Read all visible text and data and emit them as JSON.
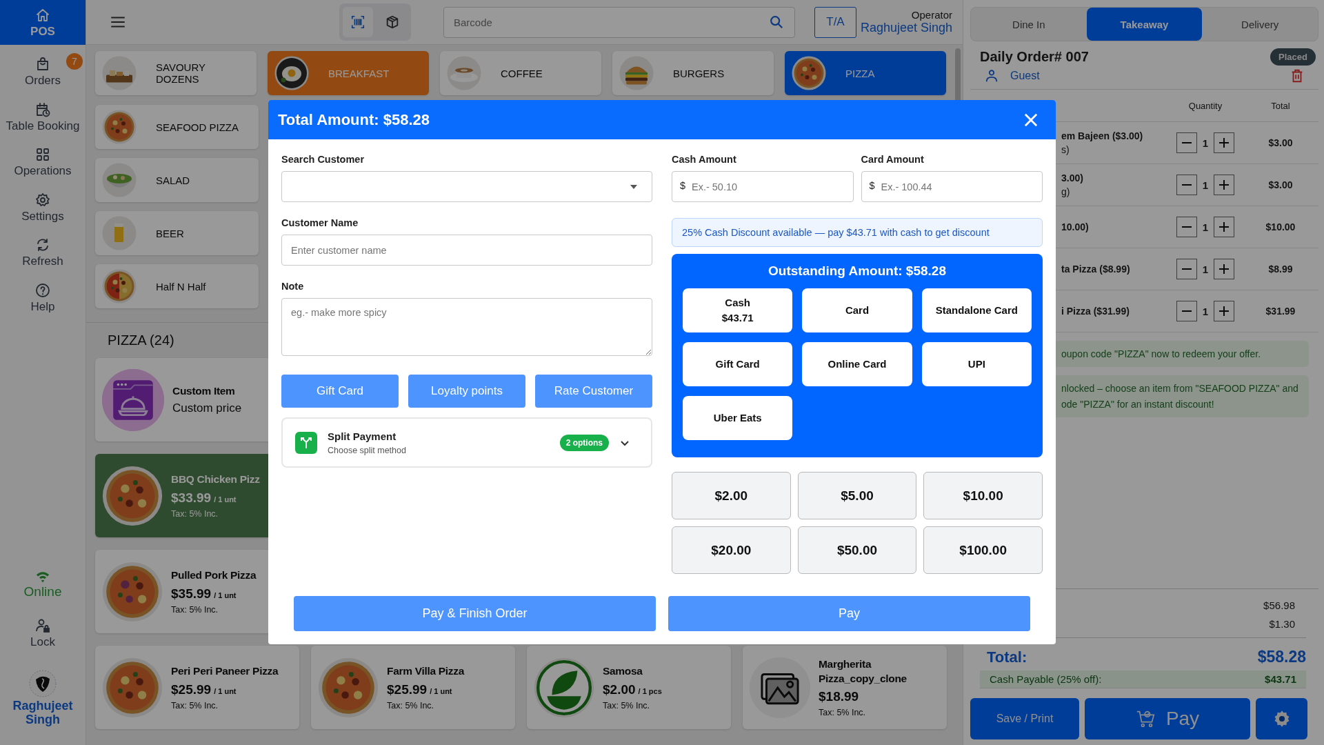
{
  "sidebar": {
    "items": [
      {
        "label": "POS",
        "selected": true
      },
      {
        "label": "Orders",
        "selected": false,
        "badge": "7"
      },
      {
        "label": "Table Booking",
        "selected": false
      },
      {
        "label": "Operations",
        "selected": false
      },
      {
        "label": "Settings",
        "selected": false
      },
      {
        "label": "Refresh",
        "selected": false
      },
      {
        "label": "Help",
        "selected": false
      }
    ],
    "status": {
      "label": "Online",
      "online": true
    },
    "lock": "Lock",
    "user": "Raghujeet Singh"
  },
  "toolbar": {
    "modes": [
      {
        "selected": true
      },
      {
        "selected": false
      }
    ],
    "search": {
      "placeholder": "Barcode"
    },
    "order_type": "T/A",
    "operator": {
      "label": "Operator",
      "name": "Raghujeet Singh"
    }
  },
  "categories": [
    {
      "label": "SAVOURY DOZENS",
      "selected": false
    },
    {
      "label": "BREAKFAST",
      "selected": false,
      "highlighted": true
    },
    {
      "label": "COFFEE",
      "selected": false
    },
    {
      "label": "BURGERS",
      "selected": false
    },
    {
      "label": "PIZZA",
      "selected": true
    },
    {
      "label": "SEAFOOD PIZZA",
      "selected": false
    },
    {
      "label": "SALAD",
      "selected": false
    },
    {
      "label": "BEER",
      "selected": false
    },
    {
      "label": "Half N Half",
      "selected": false
    }
  ],
  "section_title": "PIZZA (24)",
  "products": [
    {
      "kind": "custom",
      "name": "Custom Item",
      "subtitle": "Custom price",
      "selected": false
    },
    {
      "kind": "food",
      "name": "BBQ Chicken Pizz",
      "price": "$33.99",
      "unit": "/ 1 unt",
      "tax": "Tax: 5% Inc.",
      "selected": true
    },
    {
      "kind": "food",
      "name": "Pulled Pork Pizza",
      "price": "$35.99",
      "unit": "/ 1 unt",
      "tax": "Tax: 5% Inc.",
      "selected": false
    },
    {
      "kind": "food",
      "name": "Peri Peri Paneer Pizza",
      "price": "$25.99",
      "unit": "/ 1 unt",
      "tax": "Tax: 5% Inc.",
      "selected": false
    },
    {
      "kind": "food",
      "name": "Farm Villa Pizza",
      "price": "$25.99",
      "unit": "/ 1 unt",
      "tax": "Tax: 5% Inc.",
      "selected": false
    },
    {
      "kind": "food",
      "name": "Samosa",
      "price": "$2.00",
      "unit": "/ 1 pcs",
      "tax": "Tax: 5% Inc.",
      "selected": false
    },
    {
      "kind": "placeholder",
      "name": "Margherita Pizza_copy_clone",
      "price": "$18.99",
      "tax": "Tax: 5% Inc.",
      "selected": false
    }
  ],
  "order": {
    "tabs": [
      {
        "label": "Dine In",
        "selected": false
      },
      {
        "label": "Takeaway",
        "selected": true
      },
      {
        "label": "Delivery",
        "selected": false
      }
    ],
    "title": "Daily Order# 007",
    "status": "Placed",
    "customer": "Guest",
    "columns": [
      "Quantity",
      "Total"
    ],
    "items": [
      {
        "name": "em Bajeen ($3.00)",
        "detail": "s)",
        "quantity": "1",
        "total": "$3.00"
      },
      {
        "name": "3.00)",
        "detail": "g)",
        "quantity": "1",
        "total": "$3.00"
      },
      {
        "name": "10.00)",
        "quantity": "1",
        "total": "$10.00"
      },
      {
        "name": "ta Pizza ($8.99)",
        "quantity": "1",
        "total": "$8.99"
      },
      {
        "name": "i Pizza ($31.99)",
        "quantity": "1",
        "total": "$31.99"
      }
    ],
    "offers": [
      {
        "lines": [
          "oupon code \"PIZZA\" now to redeem your offer."
        ]
      },
      {
        "lines": [
          "nlocked – choose an item from \"SEAFOOD PIZZA\" and",
          "ode \"PIZZA\" for an instant discount!"
        ]
      }
    ],
    "amounts": [
      "$56.98",
      "$1.30"
    ],
    "total_label": "Total:",
    "total": "$58.28",
    "cash_label": "Cash Payable (25% off):",
    "cash_value": "$43.71",
    "save": "Save / Print",
    "pay": "Pay"
  },
  "dialog": {
    "title": "Total Amount: $58.28",
    "search_customer": {
      "label": "Search Customer"
    },
    "customer_name": {
      "label": "Customer Name",
      "placeholder": "Enter customer name"
    },
    "note": {
      "label": "Note",
      "placeholder": "eg.- make more spicy"
    },
    "actions": [
      "Gift Card",
      "Loyalty points",
      "Rate Customer"
    ],
    "split": {
      "title": "Split Payment",
      "subtitle": "Choose split method",
      "badge": "2 options",
      "expanded": false
    },
    "cash_amount": {
      "label": "Cash Amount",
      "prefix": "$",
      "placeholder": "Ex.- 50.10"
    },
    "card_amount": {
      "label": "Card Amount",
      "prefix": "$",
      "placeholder": "Ex.- 100.44"
    },
    "notice": "25% Cash Discount available — pay $43.71 with cash to get discount",
    "outstanding": "Outstanding Amount: $58.28",
    "methods": [
      {
        "label": "Cash",
        "amount": "$43.71"
      },
      {
        "label": "Card"
      },
      {
        "label": "Standalone Card"
      },
      {
        "label": "Gift Card"
      },
      {
        "label": "Online Card"
      },
      {
        "label": "UPI"
      },
      {
        "label": "Uber Eats"
      }
    ],
    "quick_amounts": [
      "$2.00",
      "$5.00",
      "$10.00",
      "$20.00",
      "$50.00",
      "$100.00"
    ],
    "buttons": [
      "Pay & Finish Order",
      "Pay"
    ]
  }
}
